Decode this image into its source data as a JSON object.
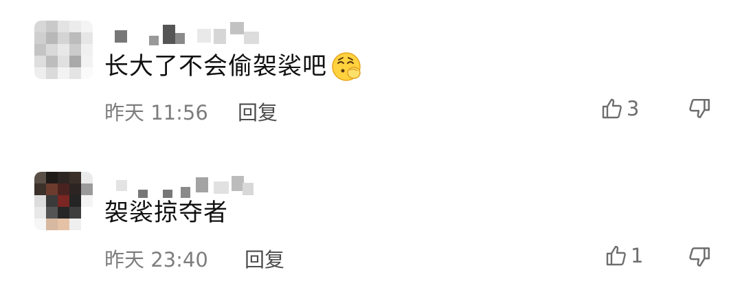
{
  "comments": [
    {
      "text": "长大了不会偷袈裟吧",
      "emoji": "shushing-face-emoji",
      "time": "昨天 11:56",
      "reply_label": "回复",
      "likes": "3"
    },
    {
      "text": "袈裟掠夺者",
      "time": "昨天 23:40",
      "reply_label": "回复",
      "likes": "1"
    }
  ],
  "icons": {
    "like": "thumbs-up-outline-icon",
    "dislike": "thumbs-down-outline-icon"
  },
  "colors": {
    "text": "#111111",
    "meta": "#7d7d7d",
    "icon": "#6d6d6d"
  }
}
